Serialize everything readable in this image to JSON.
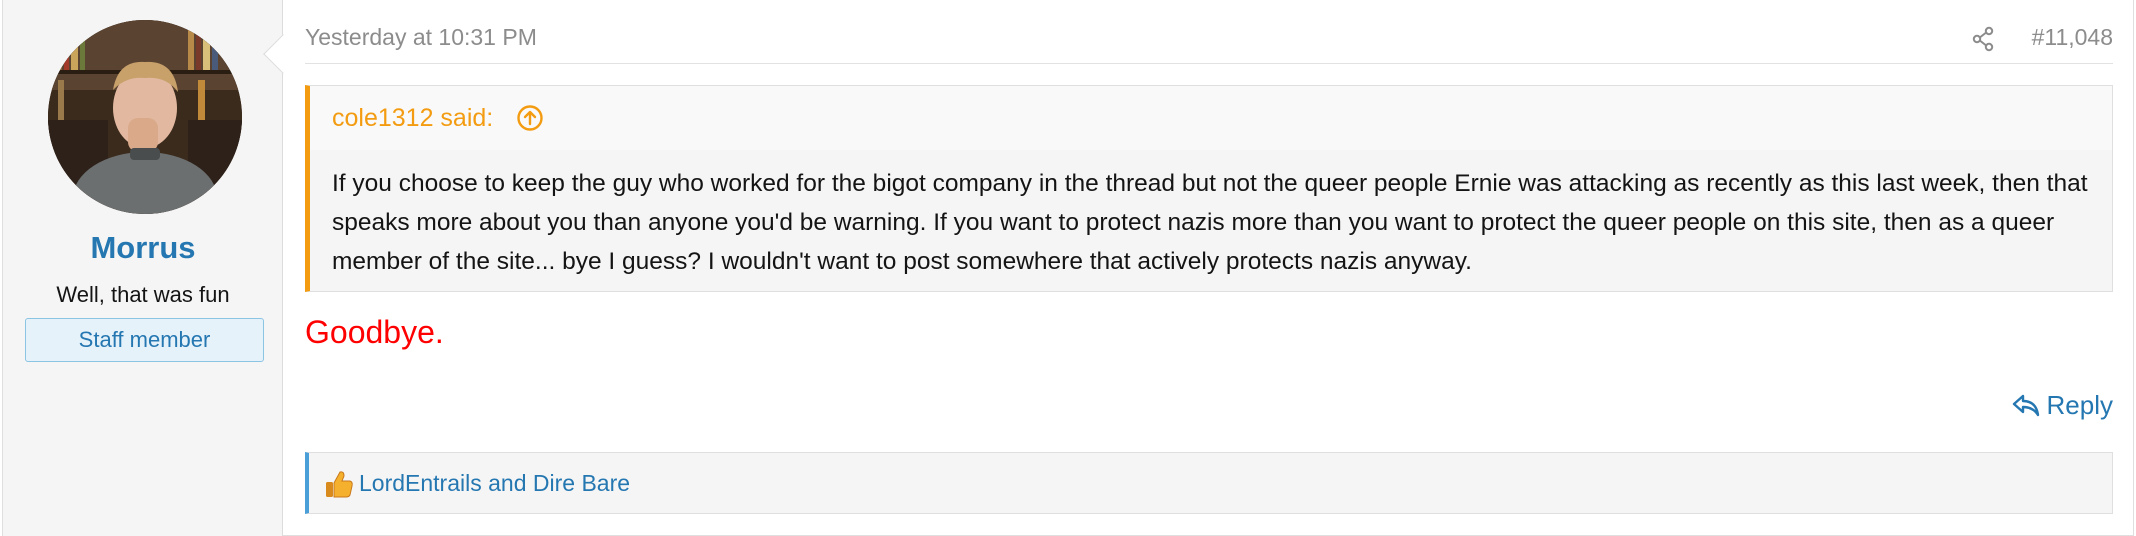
{
  "user": {
    "name": "Morrus",
    "title": "Well, that was fun",
    "banner": "Staff member"
  },
  "post": {
    "timestamp": "Yesterday at 10:31 PM",
    "number": "#11,048",
    "quote": {
      "author": "cole1312 said:",
      "text": "If you choose to keep the guy who worked for the bigot company in the thread but not the queer people Ernie was attacking as recently as this last week, then that speaks more about you than anyone you'd be warning. If you want to protect nazis more than you want to protect the queer people on this site, then as a queer member of the site... bye I guess? I wouldn't want to post somewhere that actively protects nazis anyway."
    },
    "message": "Goodbye.",
    "message_color": "#ff0000",
    "reply_label": "Reply",
    "reactions": {
      "icon": "thumbs-up-icon",
      "text": "LordEntrails and Dire Bare"
    }
  },
  "colors": {
    "link": "#2577b1",
    "quote_accent": "#f39c12",
    "reaction_accent": "#4a9fd9",
    "muted": "#8c8c8c"
  }
}
